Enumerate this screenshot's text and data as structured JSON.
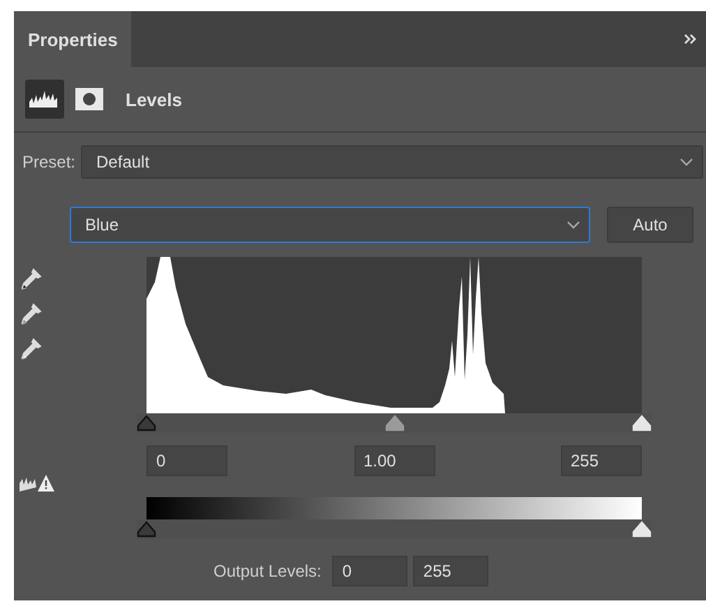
{
  "panel": {
    "tab": "Properties"
  },
  "header": {
    "title": "Levels"
  },
  "preset": {
    "label": "Preset:",
    "value": "Default"
  },
  "channel": {
    "value": "Blue",
    "focused": true
  },
  "auto_button": "Auto",
  "input_levels": {
    "sliders": [
      {
        "kind": "black",
        "level": 0
      },
      {
        "kind": "gray",
        "level": 0.5
      },
      {
        "kind": "white",
        "level": 1
      }
    ],
    "values": [
      "0",
      "1.00",
      "255"
    ]
  },
  "output_levels": {
    "sliders": [
      {
        "kind": "black",
        "level": 0
      },
      {
        "kind": "white",
        "level": 1
      }
    ],
    "label": "Output Levels:",
    "values": [
      "0",
      "255"
    ]
  }
}
